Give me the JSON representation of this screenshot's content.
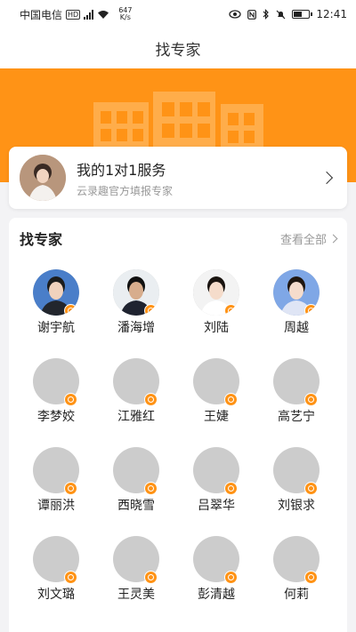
{
  "status_bar": {
    "carrier": "中国电信",
    "hd": "HD",
    "net_speed_value": "647",
    "net_speed_unit": "K/s",
    "time": "12:41",
    "icons": [
      "eye-icon",
      "nfc-icon",
      "bluetooth-icon",
      "mute-icon",
      "battery-icon"
    ]
  },
  "header": {
    "title": "找专家"
  },
  "service": {
    "title": "我的1对1服务",
    "subtitle": "云录趣官方填报专家"
  },
  "experts_section": {
    "title": "找专家",
    "view_all": "查看全部",
    "experts": [
      {
        "name": "谢宇航",
        "has_photo": true
      },
      {
        "name": "潘海增",
        "has_photo": true
      },
      {
        "name": "刘陆",
        "has_photo": true
      },
      {
        "name": "周越",
        "has_photo": true
      },
      {
        "name": "李梦姣",
        "has_photo": false
      },
      {
        "name": "江雅红",
        "has_photo": false
      },
      {
        "name": "王婕",
        "has_photo": false
      },
      {
        "name": "高艺宁",
        "has_photo": false
      },
      {
        "name": "谭丽洪",
        "has_photo": false
      },
      {
        "name": "西晓雪",
        "has_photo": false
      },
      {
        "name": "吕翠华",
        "has_photo": false
      },
      {
        "name": "刘银求",
        "has_photo": false
      },
      {
        "name": "刘文璐",
        "has_photo": false
      },
      {
        "name": "王灵美",
        "has_photo": false
      },
      {
        "name": "彭清越",
        "has_photo": false
      },
      {
        "name": "何莉",
        "has_photo": false
      }
    ]
  },
  "colors": {
    "accent": "#ff9316",
    "placeholder": "#cccccc"
  }
}
